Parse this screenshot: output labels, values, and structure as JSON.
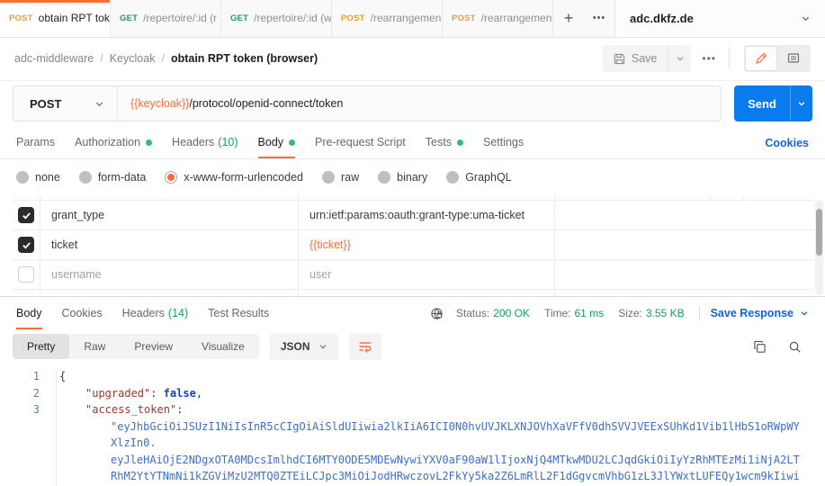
{
  "tabbar": {
    "tabs": [
      {
        "method": "POST",
        "title": "obtain RPT toke"
      },
      {
        "method": "GET",
        "title": "/repertoire/:id (r"
      },
      {
        "method": "GET",
        "title": "/repertoire/:id (w"
      },
      {
        "method": "POST",
        "title": "/rearrangemen"
      },
      {
        "method": "POST",
        "title": "/rearrangemen"
      }
    ],
    "add": "+",
    "more": "•••",
    "workspace": "adc.dkfz.de"
  },
  "header": {
    "breadcrumb": {
      "project": "adc-middleware",
      "folder": "Keycloak",
      "request": "obtain RPT token (browser)",
      "separator": "/"
    },
    "save_label": "Save",
    "more": "•••"
  },
  "url_bar": {
    "method": "POST",
    "url_variable": "{{keycloak}}",
    "url_path": "/protocol/openid-connect/token",
    "send_label": "Send"
  },
  "request_tabs": {
    "items": [
      {
        "label": "Params"
      },
      {
        "label": "Authorization",
        "dot": true
      },
      {
        "label": "Headers",
        "count": "(10)"
      },
      {
        "label": "Body",
        "dot": true,
        "active": true
      },
      {
        "label": "Pre-request Script"
      },
      {
        "label": "Tests",
        "dot": true
      },
      {
        "label": "Settings"
      }
    ],
    "cookies_link": "Cookies"
  },
  "body_modes": {
    "options": [
      "none",
      "form-data",
      "x-www-form-urlencoded",
      "raw",
      "binary",
      "GraphQL"
    ],
    "selected": "x-www-form-urlencoded"
  },
  "form_params": [
    {
      "checked": true,
      "key": "grant_type",
      "value": "urn:ietf:params:oauth:grant-type:uma-ticket",
      "variable": false,
      "disabled": false
    },
    {
      "checked": true,
      "key": "ticket",
      "value": "{{ticket}}",
      "variable": true,
      "disabled": false
    },
    {
      "checked": false,
      "key": "username",
      "value": "user",
      "variable": false,
      "disabled": true
    }
  ],
  "response": {
    "tabs": [
      {
        "label": "Body",
        "active": true
      },
      {
        "label": "Cookies"
      },
      {
        "label": "Headers",
        "count": "(14)"
      },
      {
        "label": "Test Results"
      }
    ],
    "meta": {
      "status_label": "Status:",
      "status_value": "200 OK",
      "time_label": "Time:",
      "time_value": "61 ms",
      "size_label": "Size:",
      "size_value": "3.55 KB"
    },
    "save_response": "Save Response",
    "view_tabs": [
      "Pretty",
      "Raw",
      "Preview",
      "Visualize"
    ],
    "language": "JSON",
    "body": {
      "line1": {
        "num": "1",
        "brace": "{"
      },
      "line2": {
        "num": "2",
        "key": "\"upgraded\"",
        "sep": ": ",
        "value": "false",
        "tail": ","
      },
      "line3": {
        "num": "3",
        "key": "\"access_token\"",
        "sep": ":"
      },
      "wrap1": "\"eyJhbGciOiJSUzI1NiIsInR5cCIgOiAiSldUIiwia2lkIiA6ICI0N0hvUVJKLXNJOVhXaVFfV0dhSVVJVEExSUhKd1Vib1lHbS1oRWpWY",
      "wrap2": "XlzIn0.",
      "wrap3": "eyJleHAiOjE2NDgxOTA0MDcsImlhdCI6MTY0ODE5MDEwNywiYXV0aF90aW1lIjoxNjQ4MTkwMDU2LCJqdGkiOiIyYzRhMTEzMi1iNjA2LT",
      "wrap4": "RhM2YtYTNmNi1kZGViMzU2MTQ0ZTEiLCJpc3MiOiJodHRwczovL2FkYy5ka2Z6LmRlL2F1dGgvcmVhbG1zL3JlYWxtLUFEQy1wcm9kIiwi"
    }
  },
  "colors": {
    "accent_orange": "#ff6c37",
    "send_blue": "#097bed",
    "link_blue": "#1065d8",
    "status_green": "#12a05c",
    "method_get": "#1ba05b",
    "method_post": "#e5a134"
  }
}
